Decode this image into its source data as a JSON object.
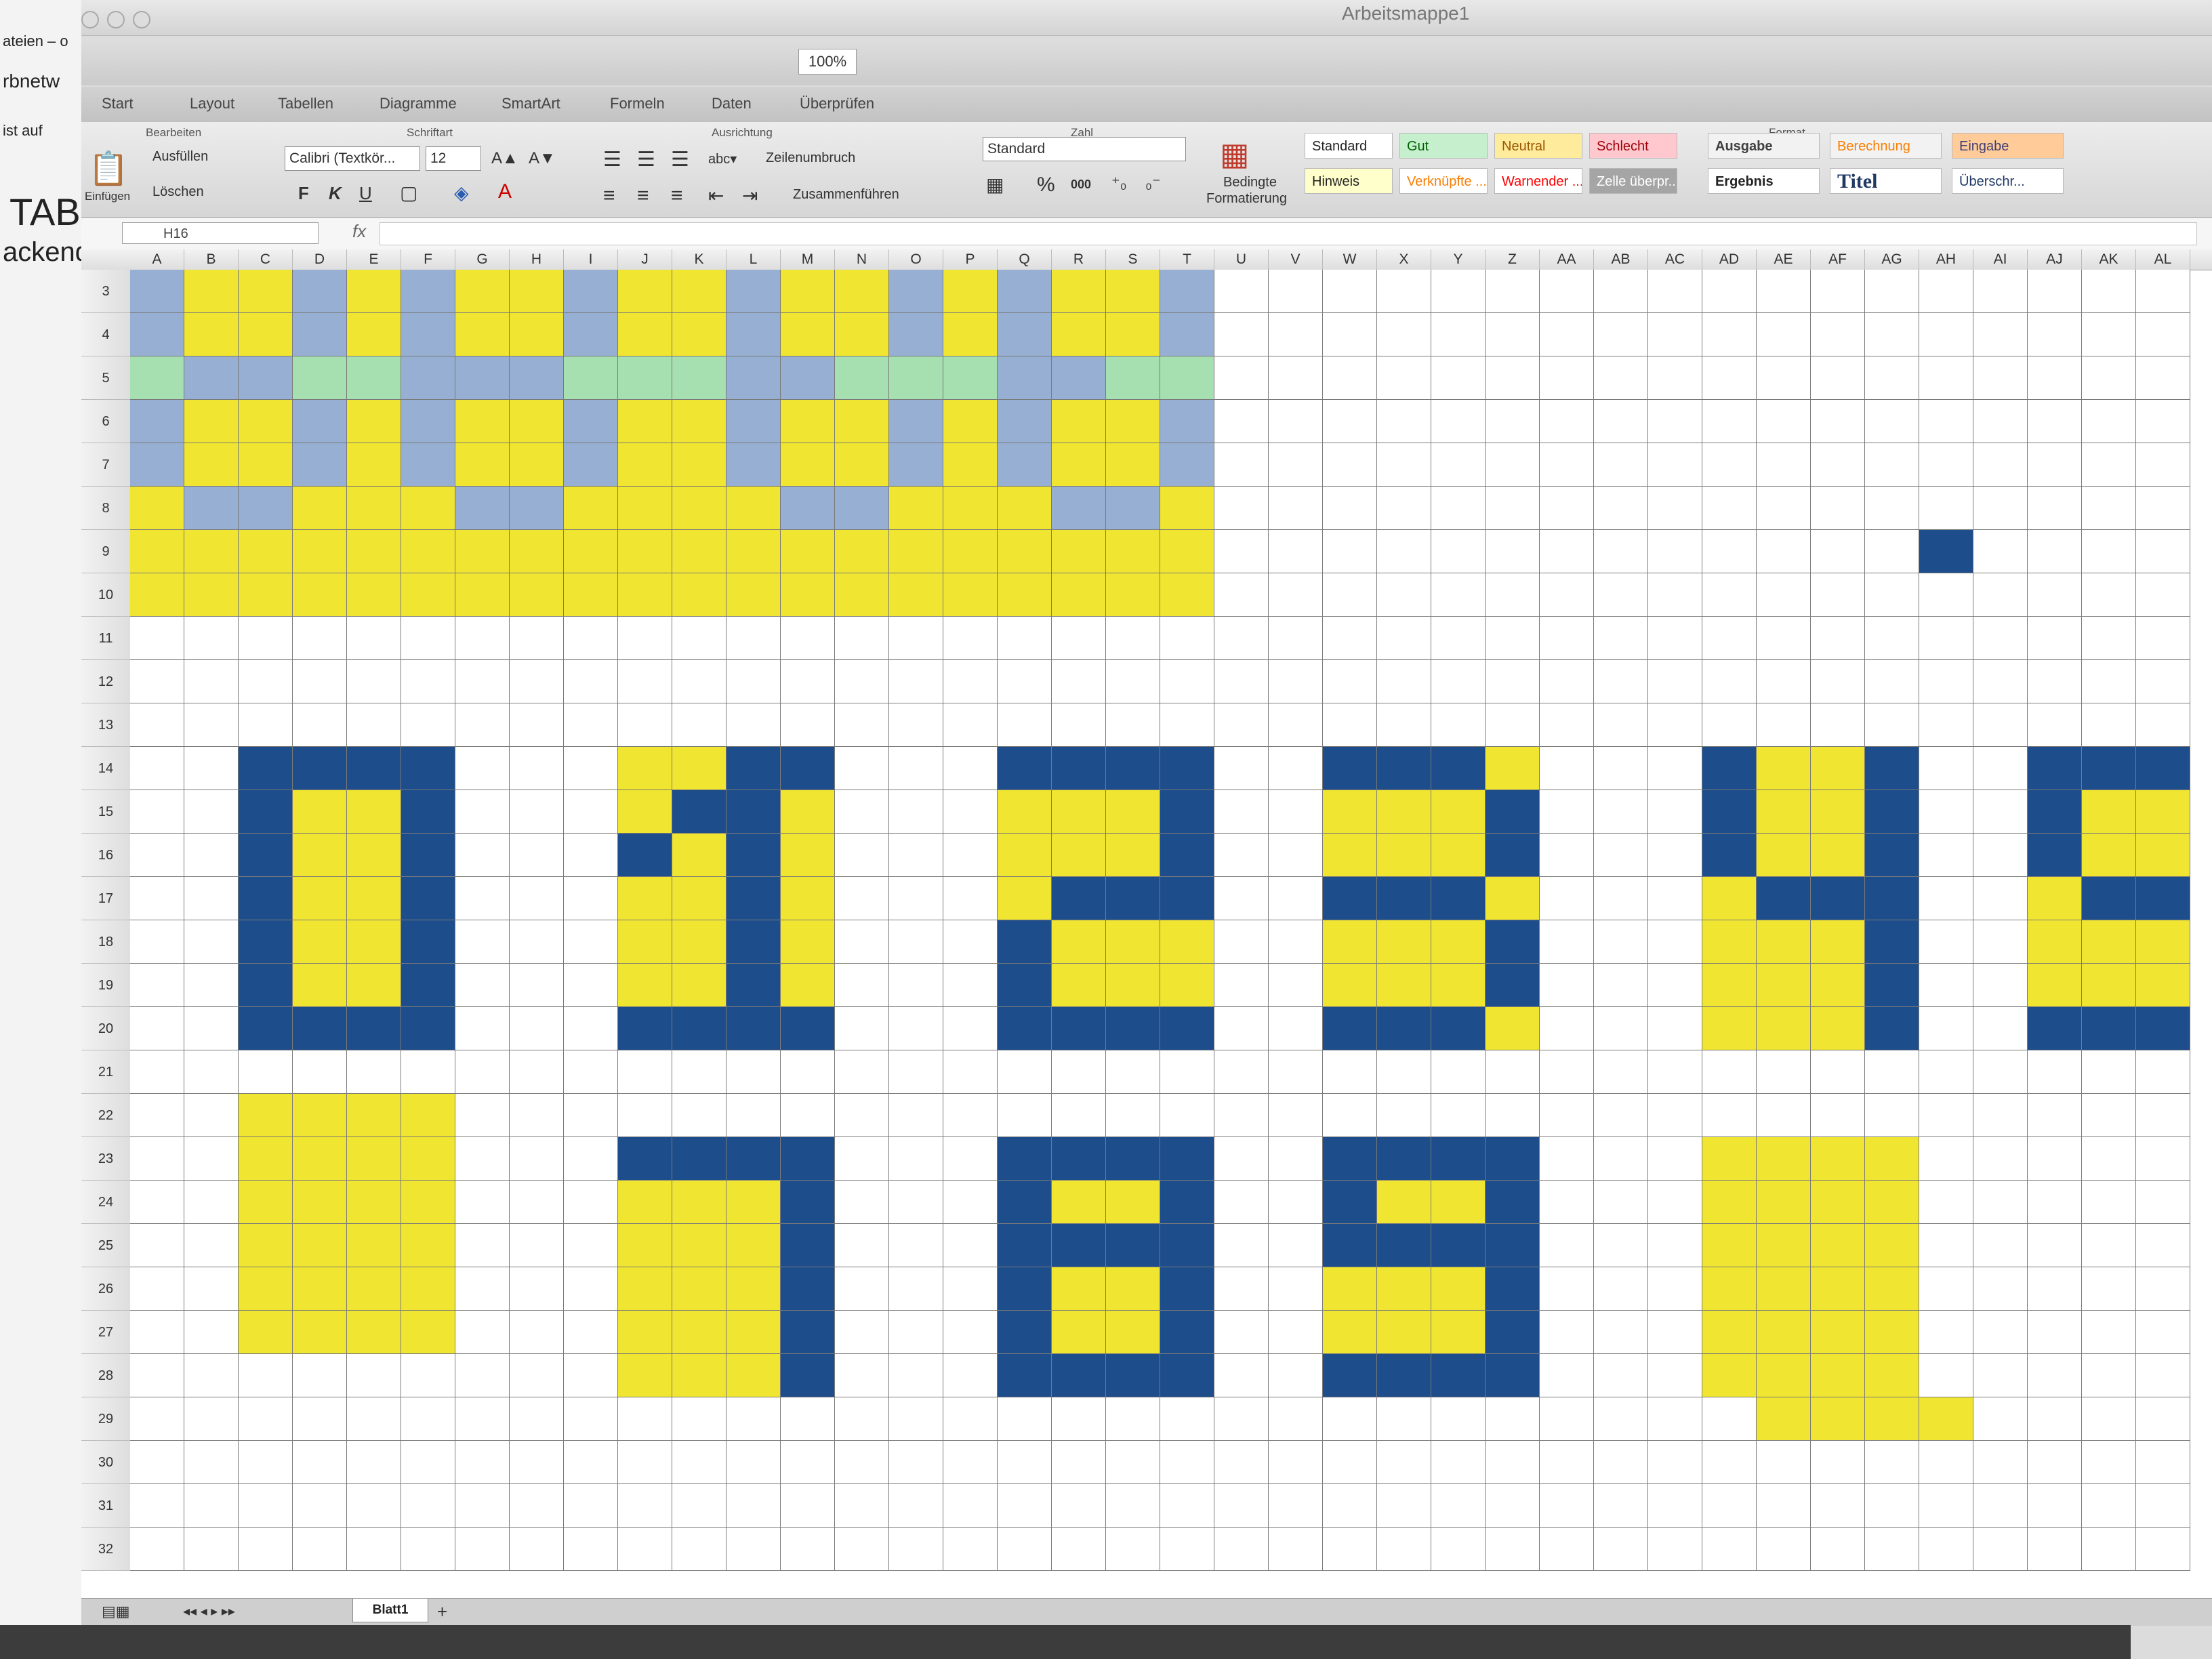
{
  "left_window": {
    "line1": "ateien – o",
    "line2": "rbnetw",
    "line3": "ist auf",
    "line4": "TAB",
    "line5": "ackend"
  },
  "app": {
    "title": "Arbeitsmappe1",
    "zoom": "100%"
  },
  "ribbon_tabs": [
    "Start",
    "Layout",
    "Tabellen",
    "Diagramme",
    "SmartArt",
    "Formeln",
    "Daten",
    "Überprüfen"
  ],
  "ribbon": {
    "groups": {
      "bearbeiten": "Bearbeiten",
      "schriftart": "Schriftart",
      "ausrichtung": "Ausrichtung",
      "zahl": "Zahl",
      "format": "Format"
    },
    "einfuegen": "Einfügen",
    "ausfuellen": "Ausfüllen",
    "loeschen": "Löschen",
    "font_name": "Calibri (Textkör...",
    "font_size": "12",
    "bold": "F",
    "italic": "K",
    "underline": "U",
    "wrap": "Zeilenumbruch",
    "merge": "Zusammenführen",
    "number_format": "Standard",
    "percent": "%",
    "thousands": "000",
    "cond_format_1": "Bedingte",
    "cond_format_2": "Formatierung",
    "styles": [
      {
        "label": "Standard",
        "bg": "#ffffff",
        "color": "#222222"
      },
      {
        "label": "Gut",
        "bg": "#c6efce",
        "color": "#006100"
      },
      {
        "label": "Neutral",
        "bg": "#ffeb9c",
        "color": "#9c5700"
      },
      {
        "label": "Schlecht",
        "bg": "#ffc7ce",
        "color": "#9c0006"
      },
      {
        "label": "Ausgabe",
        "bg": "#f2f2f2",
        "color": "#3f3f3f"
      },
      {
        "label": "Berechnung",
        "bg": "#f2f2f2",
        "color": "#fa7d00"
      },
      {
        "label": "Eingabe",
        "bg": "#ffcc99",
        "color": "#3f3f76"
      },
      {
        "label": "Hinweis",
        "bg": "#ffffcc",
        "color": "#222222"
      },
      {
        "label": "Verknüpfte ...",
        "bg": "#ffffff",
        "color": "#fa7d00"
      },
      {
        "label": "Warnender ...",
        "bg": "#ffffff",
        "color": "#ff0000"
      },
      {
        "label": "Zelle überpr...",
        "bg": "#a5a5a5",
        "color": "#ffffff"
      },
      {
        "label": "Ergebnis",
        "bg": "#ffffff",
        "color": "#222222"
      },
      {
        "label": "Titel",
        "bg": "#ffffff",
        "color": "#1f3864"
      },
      {
        "label": "Überschr...",
        "bg": "#ffffff",
        "color": "#1f3864"
      }
    ]
  },
  "formula_bar": {
    "name_box": "H16",
    "fx": "fx",
    "value": ""
  },
  "columns": [
    "A",
    "B",
    "C",
    "D",
    "E",
    "F",
    "G",
    "H",
    "I",
    "J",
    "K",
    "L",
    "M",
    "N",
    "O",
    "P",
    "Q",
    "R",
    "S",
    "T",
    "U",
    "V",
    "W",
    "X",
    "Y",
    "Z",
    "AA",
    "AB",
    "AC",
    "AD",
    "AE",
    "AF",
    "AG",
    "AH",
    "AI",
    "AJ",
    "AK",
    "AL"
  ],
  "rows": [
    "3",
    "4",
    "5",
    "6",
    "7",
    "8",
    "9",
    "10",
    "11",
    "12",
    "13",
    "14",
    "15",
    "16",
    "17",
    "18",
    "19",
    "20",
    "21",
    "22",
    "23",
    "24",
    "25",
    "26",
    "27",
    "28",
    "29",
    "30",
    "31",
    "32"
  ],
  "colors": {
    "yellow": "#f0e530",
    "blue_gray": "#96afd2",
    "green": "#a6dfb0",
    "navy": "#1d4d8a",
    "empty": "#ffffff"
  },
  "grid_pattern": [
    "BYYBYBYYBYYBYYBYBYYB..................",
    "BYYBYBYYBYYBYYBYBYYB..................",
    "GBBGGBBBGGGBBGGGBBGG..................",
    "BYYBYBYYBYYBYYBYBYYB..................",
    "BYYBYBYYBYYBYYBYBYYB..................",
    "YBBYYYBBYYYYBBYYYBBY..................",
    "YYYYYYYYYYYYYYYYYYYY.............N....",
    "YYYYYYYYYYYYYYYYYYYY..................",
    "......................................",
    "......................................",
    "......................................",
    "..NNNN...YYNN...NNNN..NNNY...NYYN..NNNN.",
    "..NYYN...YNNY...YYYN..YYYN...NYYN..NYYY.",
    "..NYYN...NYNY...YYYN..YYYN...NYYN..NYYY.",
    "..NYYN...YYNY...YNNN..NNNY...YNNN..YNNY.",
    "..NYYN...YYNY...NYYY..YYYN...YYYN..YYYN.",
    "..NYYN...YYNY...NYYY..YYYN...YYYN..YYYN.",
    "..NNNN...NNNN...NNNN..NNNY...YYYN..NNNN.",
    "......................................",
    "..YYYY................................",
    "..YYYY...NNNN...NNNN..NNNN...YYYY.......",
    "..YYYY...YYYN...NYYN..NYYN...YYYY.......",
    "..YYYY...YYYN...NNNN..NNNN...YYYY.......",
    "..YYYY...YYYN...NYYN..YYYN...YYYY.......",
    "..YYYY...YYYN...NYYN..YYYN...YYYY.......",
    ".........YYYN...NNNN..NNNN...YYYY.......",
    "..............................YYYY......",
    "......................................",
    "......................................"
  ],
  "sheet_tab": "Blatt1",
  "add_sheet": "+"
}
